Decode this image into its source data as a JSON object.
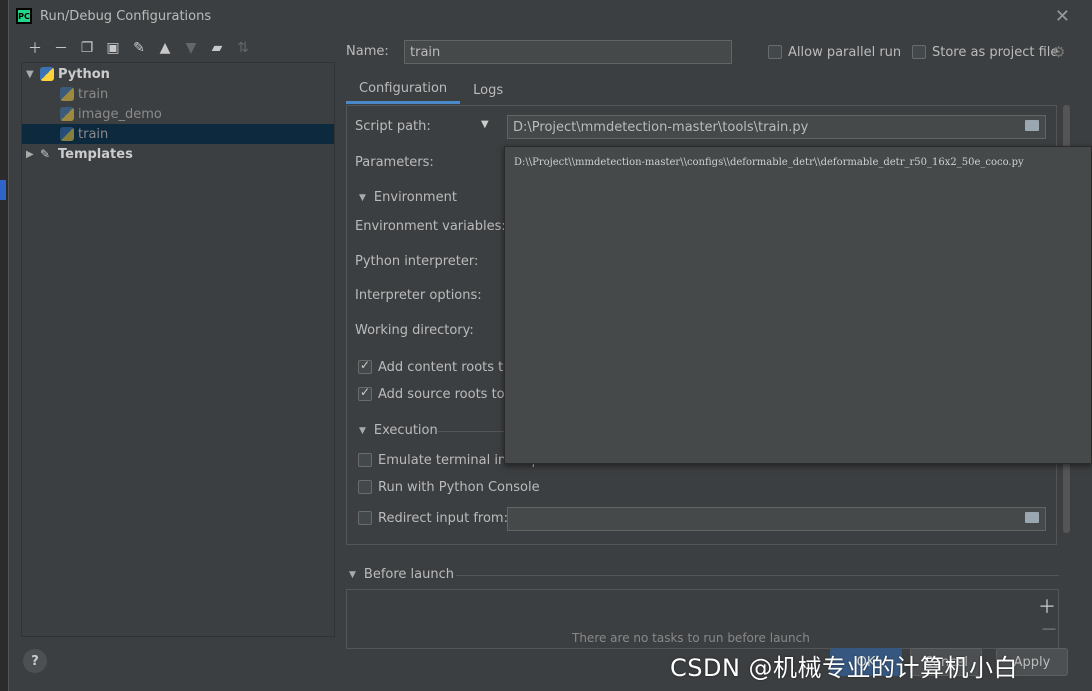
{
  "window": {
    "title": "Run/Debug Configurations",
    "app_badge": "PC"
  },
  "toolbar": {
    "icons": [
      "add-icon",
      "remove-icon",
      "copy-icon",
      "save-icon",
      "wrench-icon",
      "move-up-icon",
      "move-down-icon",
      "folder-icon",
      "sort-icon"
    ]
  },
  "tree": {
    "python_label": "Python",
    "items": [
      {
        "label": "train"
      },
      {
        "label": "image_demo"
      },
      {
        "label": "train"
      }
    ],
    "templates_label": "Templates"
  },
  "header": {
    "name_label": "Name:",
    "name_value": "train",
    "allow_parallel_label": "Allow parallel run",
    "store_project_label": "Store as project file"
  },
  "tabs": [
    {
      "label": "Configuration"
    },
    {
      "label": "Logs"
    }
  ],
  "config": {
    "script_path_label": "Script path:",
    "script_path_value": "D:\\Project\\mmdetection-master\\tools\\train.py",
    "parameters_label": "Parameters:",
    "parameters_popup_value": "D:\\\\Project\\\\mmdetection-master\\\\configs\\\\deformable_detr\\\\deformable_detr_r50_16x2_50e_coco.py",
    "environment_section": "Environment",
    "env_vars_label": "Environment variables:",
    "python_interpreter_label": "Python interpreter:",
    "interpreter_options_label": "Interpreter options:",
    "working_dir_label": "Working directory:",
    "add_content_roots_label": "Add content roots to",
    "add_source_roots_label": "Add source roots to F",
    "execution_section": "Execution",
    "emulate_terminal_label": "Emulate terminal in output console",
    "run_python_console_label": "Run with Python Console",
    "redirect_input_label": "Redirect input from:"
  },
  "before_launch": {
    "label": "Before launch",
    "hint": "There are no tasks to run before launch"
  },
  "buttons": {
    "ok": "OK",
    "cancel": "Cancel",
    "apply": "Apply",
    "help": "?"
  },
  "watermark": "CSDN @机械专业的计算机小白",
  "colors": {
    "accent": "#4a88c7",
    "selection": "#0d293e",
    "ok_button": "#365880"
  }
}
